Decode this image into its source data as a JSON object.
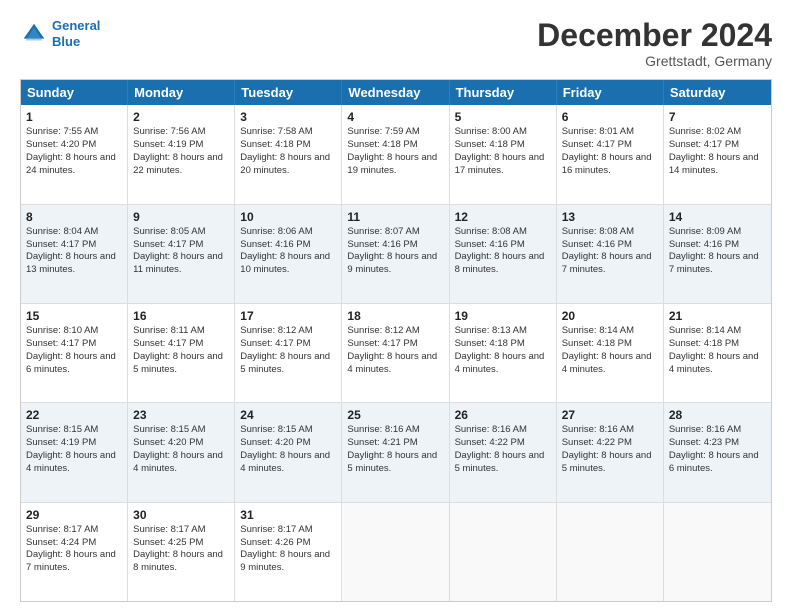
{
  "logo": {
    "line1": "General",
    "line2": "Blue"
  },
  "title": "December 2024",
  "location": "Grettstadt, Germany",
  "header_days": [
    "Sunday",
    "Monday",
    "Tuesday",
    "Wednesday",
    "Thursday",
    "Friday",
    "Saturday"
  ],
  "rows": [
    [
      {
        "day": "1",
        "sunrise": "Sunrise: 7:55 AM",
        "sunset": "Sunset: 4:20 PM",
        "daylight": "Daylight: 8 hours and 24 minutes."
      },
      {
        "day": "2",
        "sunrise": "Sunrise: 7:56 AM",
        "sunset": "Sunset: 4:19 PM",
        "daylight": "Daylight: 8 hours and 22 minutes."
      },
      {
        "day": "3",
        "sunrise": "Sunrise: 7:58 AM",
        "sunset": "Sunset: 4:18 PM",
        "daylight": "Daylight: 8 hours and 20 minutes."
      },
      {
        "day": "4",
        "sunrise": "Sunrise: 7:59 AM",
        "sunset": "Sunset: 4:18 PM",
        "daylight": "Daylight: 8 hours and 19 minutes."
      },
      {
        "day": "5",
        "sunrise": "Sunrise: 8:00 AM",
        "sunset": "Sunset: 4:18 PM",
        "daylight": "Daylight: 8 hours and 17 minutes."
      },
      {
        "day": "6",
        "sunrise": "Sunrise: 8:01 AM",
        "sunset": "Sunset: 4:17 PM",
        "daylight": "Daylight: 8 hours and 16 minutes."
      },
      {
        "day": "7",
        "sunrise": "Sunrise: 8:02 AM",
        "sunset": "Sunset: 4:17 PM",
        "daylight": "Daylight: 8 hours and 14 minutes."
      }
    ],
    [
      {
        "day": "8",
        "sunrise": "Sunrise: 8:04 AM",
        "sunset": "Sunset: 4:17 PM",
        "daylight": "Daylight: 8 hours and 13 minutes."
      },
      {
        "day": "9",
        "sunrise": "Sunrise: 8:05 AM",
        "sunset": "Sunset: 4:17 PM",
        "daylight": "Daylight: 8 hours and 11 minutes."
      },
      {
        "day": "10",
        "sunrise": "Sunrise: 8:06 AM",
        "sunset": "Sunset: 4:16 PM",
        "daylight": "Daylight: 8 hours and 10 minutes."
      },
      {
        "day": "11",
        "sunrise": "Sunrise: 8:07 AM",
        "sunset": "Sunset: 4:16 PM",
        "daylight": "Daylight: 8 hours and 9 minutes."
      },
      {
        "day": "12",
        "sunrise": "Sunrise: 8:08 AM",
        "sunset": "Sunset: 4:16 PM",
        "daylight": "Daylight: 8 hours and 8 minutes."
      },
      {
        "day": "13",
        "sunrise": "Sunrise: 8:08 AM",
        "sunset": "Sunset: 4:16 PM",
        "daylight": "Daylight: 8 hours and 7 minutes."
      },
      {
        "day": "14",
        "sunrise": "Sunrise: 8:09 AM",
        "sunset": "Sunset: 4:16 PM",
        "daylight": "Daylight: 8 hours and 7 minutes."
      }
    ],
    [
      {
        "day": "15",
        "sunrise": "Sunrise: 8:10 AM",
        "sunset": "Sunset: 4:17 PM",
        "daylight": "Daylight: 8 hours and 6 minutes."
      },
      {
        "day": "16",
        "sunrise": "Sunrise: 8:11 AM",
        "sunset": "Sunset: 4:17 PM",
        "daylight": "Daylight: 8 hours and 5 minutes."
      },
      {
        "day": "17",
        "sunrise": "Sunrise: 8:12 AM",
        "sunset": "Sunset: 4:17 PM",
        "daylight": "Daylight: 8 hours and 5 minutes."
      },
      {
        "day": "18",
        "sunrise": "Sunrise: 8:12 AM",
        "sunset": "Sunset: 4:17 PM",
        "daylight": "Daylight: 8 hours and 4 minutes."
      },
      {
        "day": "19",
        "sunrise": "Sunrise: 8:13 AM",
        "sunset": "Sunset: 4:18 PM",
        "daylight": "Daylight: 8 hours and 4 minutes."
      },
      {
        "day": "20",
        "sunrise": "Sunrise: 8:14 AM",
        "sunset": "Sunset: 4:18 PM",
        "daylight": "Daylight: 8 hours and 4 minutes."
      },
      {
        "day": "21",
        "sunrise": "Sunrise: 8:14 AM",
        "sunset": "Sunset: 4:18 PM",
        "daylight": "Daylight: 8 hours and 4 minutes."
      }
    ],
    [
      {
        "day": "22",
        "sunrise": "Sunrise: 8:15 AM",
        "sunset": "Sunset: 4:19 PM",
        "daylight": "Daylight: 8 hours and 4 minutes."
      },
      {
        "day": "23",
        "sunrise": "Sunrise: 8:15 AM",
        "sunset": "Sunset: 4:20 PM",
        "daylight": "Daylight: 8 hours and 4 minutes."
      },
      {
        "day": "24",
        "sunrise": "Sunrise: 8:15 AM",
        "sunset": "Sunset: 4:20 PM",
        "daylight": "Daylight: 8 hours and 4 minutes."
      },
      {
        "day": "25",
        "sunrise": "Sunrise: 8:16 AM",
        "sunset": "Sunset: 4:21 PM",
        "daylight": "Daylight: 8 hours and 5 minutes."
      },
      {
        "day": "26",
        "sunrise": "Sunrise: 8:16 AM",
        "sunset": "Sunset: 4:22 PM",
        "daylight": "Daylight: 8 hours and 5 minutes."
      },
      {
        "day": "27",
        "sunrise": "Sunrise: 8:16 AM",
        "sunset": "Sunset: 4:22 PM",
        "daylight": "Daylight: 8 hours and 5 minutes."
      },
      {
        "day": "28",
        "sunrise": "Sunrise: 8:16 AM",
        "sunset": "Sunset: 4:23 PM",
        "daylight": "Daylight: 8 hours and 6 minutes."
      }
    ],
    [
      {
        "day": "29",
        "sunrise": "Sunrise: 8:17 AM",
        "sunset": "Sunset: 4:24 PM",
        "daylight": "Daylight: 8 hours and 7 minutes."
      },
      {
        "day": "30",
        "sunrise": "Sunrise: 8:17 AM",
        "sunset": "Sunset: 4:25 PM",
        "daylight": "Daylight: 8 hours and 8 minutes."
      },
      {
        "day": "31",
        "sunrise": "Sunrise: 8:17 AM",
        "sunset": "Sunset: 4:26 PM",
        "daylight": "Daylight: 8 hours and 9 minutes."
      },
      null,
      null,
      null,
      null
    ]
  ]
}
